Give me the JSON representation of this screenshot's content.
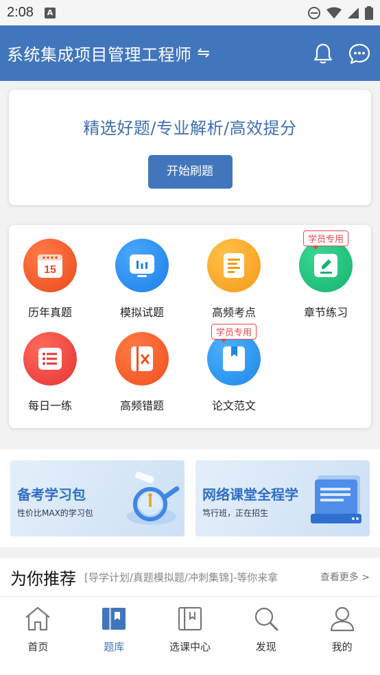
{
  "status_bar": {
    "time": "2:08",
    "notification_icon": "A"
  },
  "header": {
    "title": "系统集成项目管理工程师",
    "switch_symbol": "⇋",
    "bell_icon": "bell-icon",
    "message_icon": "chat-icon"
  },
  "promo": {
    "headline": "精选好题/专业解析/高效提分",
    "button_label": "开始刷题"
  },
  "grid": {
    "badge_text": "学员专用",
    "items": [
      {
        "label": "历年真题",
        "icon": "calendar-icon",
        "color": "#f0532d",
        "calendar_number": "15"
      },
      {
        "label": "模拟试题",
        "icon": "monitor-chart-icon",
        "color": "#2a8df0"
      },
      {
        "label": "高频考点",
        "icon": "document-icon",
        "color": "#f6a623"
      },
      {
        "label": "章节练习",
        "icon": "edit-note-icon",
        "color": "#22c07f"
      },
      {
        "label": "每日一练",
        "icon": "list-icon",
        "color": "#ee3e3e"
      },
      {
        "label": "高频错题",
        "icon": "wrong-book-icon",
        "color": "#f45a2c"
      },
      {
        "label": "论文范文",
        "icon": "bookmark-book-icon",
        "color": "#2a95ee"
      }
    ]
  },
  "banners": [
    {
      "title": "备考学习包",
      "subtitle": "性价比MAX的学习包"
    },
    {
      "title": "网络课堂全程学",
      "subtitle": "笃行班，正在招生"
    }
  ],
  "recommend": {
    "title": "为你推荐",
    "subtitle": "[导学计划/真题模拟题/冲刺集锦]-等你来拿",
    "more": "查看更多 >"
  },
  "bottom_nav": [
    {
      "label": "首页",
      "icon": "home-icon",
      "active": false
    },
    {
      "label": "题库",
      "icon": "question-bank-icon",
      "active": true
    },
    {
      "label": "选课中心",
      "icon": "course-icon",
      "active": false
    },
    {
      "label": "发现",
      "icon": "search-icon",
      "active": false
    },
    {
      "label": "我的",
      "icon": "profile-icon",
      "active": false
    }
  ],
  "colors": {
    "primary": "#4176bd",
    "badge_red": "#e9474a"
  }
}
